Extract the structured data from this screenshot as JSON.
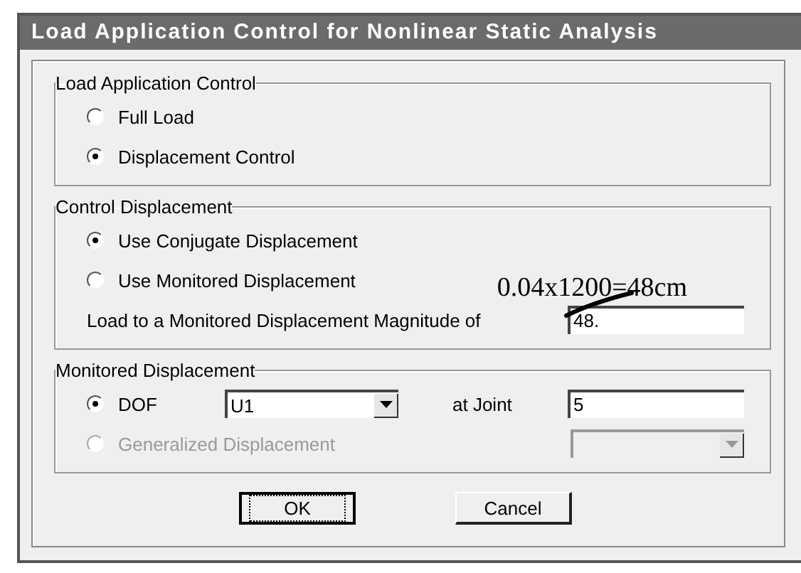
{
  "window": {
    "title": "Load Application Control for Nonlinear Static Analysis"
  },
  "groups": [
    {
      "title": "Load Application Control",
      "rows": [
        {
          "kind": "radio",
          "label": "Full Load",
          "selected": false,
          "disabled": false
        },
        {
          "kind": "radio",
          "label": "Displacement Control",
          "selected": true,
          "disabled": false
        }
      ]
    },
    {
      "title": "Control Displacement",
      "rows": [
        {
          "kind": "radio",
          "label": "Use Conjugate Displacement",
          "selected": true,
          "disabled": false
        },
        {
          "kind": "radio",
          "label": "Use Monitored Displacement",
          "selected": false,
          "disabled": false
        },
        {
          "kind": "field",
          "label": "Load to a Monitored Displacement Magnitude of",
          "value": "48."
        }
      ]
    },
    {
      "title": "Monitored Displacement",
      "rows": [
        {
          "kind": "line",
          "cells": [
            {
              "kind": "radio",
              "label": "DOF",
              "selected": true,
              "disabled": false
            },
            {
              "kind": "select",
              "value": "U1",
              "disabled": false
            },
            {
              "kind": "label",
              "text": "at Joint"
            },
            {
              "kind": "text",
              "value": "5"
            }
          ]
        },
        {
          "kind": "line",
          "cells": [
            {
              "kind": "radio",
              "label": "Generalized Displacement",
              "selected": false,
              "disabled": true
            },
            {
              "kind": "select",
              "disabled": true
            }
          ]
        }
      ]
    }
  ],
  "buttons": [
    {
      "label": "OK",
      "focused": true
    },
    {
      "label": "Cancel",
      "focused": false
    }
  ],
  "annotation": {
    "text": "0.04x1200=48cm"
  }
}
